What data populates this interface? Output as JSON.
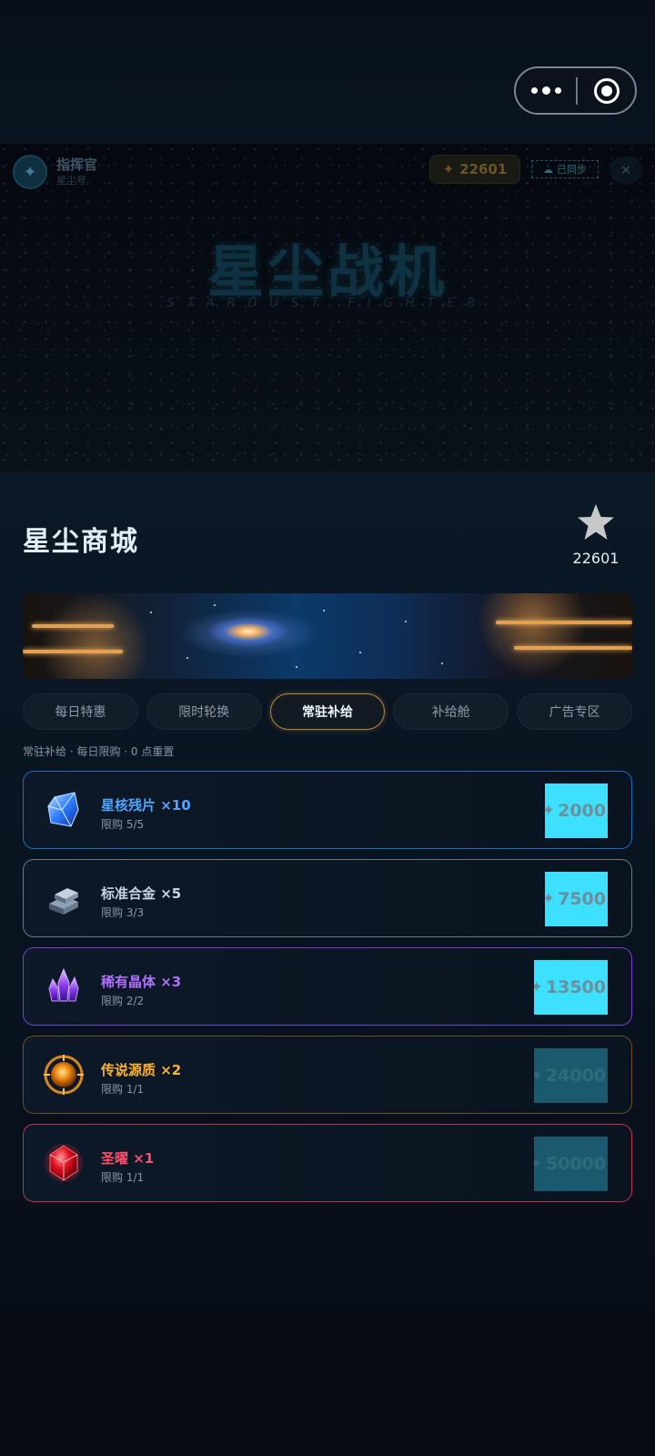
{
  "system": {
    "more_icon": "more-dots-icon",
    "target_icon": "target-icon"
  },
  "game": {
    "player_name": "指挥官",
    "player_sub": "星尘号",
    "coins": "22601",
    "sync_label": "已同步",
    "close_label": "×",
    "title": "星尘战机",
    "subtitle": "STARDUST FIGHTER"
  },
  "shop": {
    "title": "星尘商城",
    "balance": "22601",
    "tabs": [
      {
        "label": "每日特惠",
        "active": false
      },
      {
        "label": "限时轮换",
        "active": false
      },
      {
        "label": "常驻补给",
        "active": true
      },
      {
        "label": "补给舱",
        "active": false
      },
      {
        "label": "广告专区",
        "active": false
      }
    ],
    "note": "常驻补给 · 每日限购 · 0 点重置",
    "items": [
      {
        "name": "星核残片 ×10",
        "limit": "限购 5/5",
        "price": "2000",
        "color": "#4ea6ff",
        "border": "#1a6fb8",
        "icon": "blue-crystal-shard-icon",
        "affordable": true
      },
      {
        "name": "标准合金 ×5",
        "limit": "限购 3/3",
        "price": "7500",
        "color": "#c9d3e0",
        "border": "#6a7686",
        "icon": "metal-ingot-icon",
        "affordable": true
      },
      {
        "name": "稀有晶体 ×3",
        "limit": "限购 2/2",
        "price": "13500",
        "color": "#b070ff",
        "border": "#7c3fd4",
        "icon": "purple-crystal-icon",
        "affordable": true
      },
      {
        "name": "传说源质 ×2",
        "limit": "限购 1/1",
        "price": "24000",
        "color": "#ffb431",
        "border": "#6b5020",
        "icon": "orange-orb-icon",
        "affordable": false
      },
      {
        "name": "圣曜 ×1",
        "limit": "限购 1/1",
        "price": "50000",
        "color": "#ff4d6a",
        "border": "#c43050",
        "icon": "red-gem-icon",
        "affordable": false
      }
    ]
  }
}
